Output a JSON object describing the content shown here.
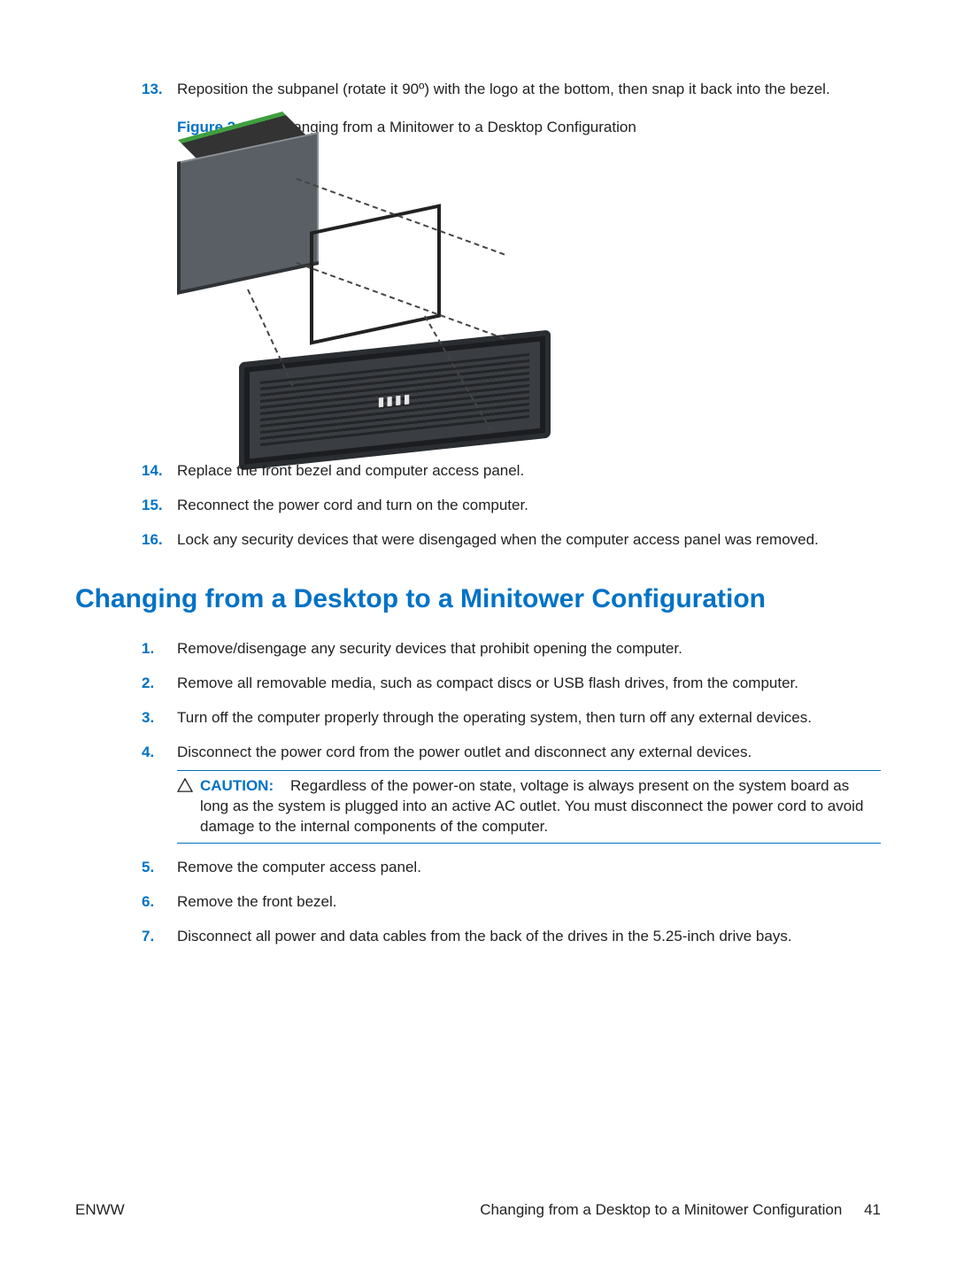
{
  "continued_steps": {
    "items": [
      {
        "num": "13.",
        "text": "Reposition the subpanel (rotate it 90º) with the logo at the bottom, then snap it back into the bezel."
      },
      {
        "num": "14.",
        "text": "Replace the front bezel and computer access panel."
      },
      {
        "num": "15.",
        "text": "Reconnect the power cord and turn on the computer."
      },
      {
        "num": "16.",
        "text": "Lock any security devices that were disengaged when the computer access panel was removed."
      }
    ]
  },
  "figure": {
    "label": "Figure 2-39",
    "caption": "Changing from a Minitower to a Desktop Configuration"
  },
  "section_heading": "Changing from a Desktop to a Minitower Configuration",
  "new_steps": {
    "items": [
      {
        "num": "1.",
        "text": "Remove/disengage any security devices that prohibit opening the computer."
      },
      {
        "num": "2.",
        "text": "Remove all removable media, such as compact discs or USB flash drives, from the computer."
      },
      {
        "num": "3.",
        "text": "Turn off the computer properly through the operating system, then turn off any external devices."
      },
      {
        "num": "4.",
        "text": "Disconnect the power cord from the power outlet and disconnect any external devices."
      },
      {
        "num": "5.",
        "text": "Remove the computer access panel."
      },
      {
        "num": "6.",
        "text": "Remove the front bezel."
      },
      {
        "num": "7.",
        "text": "Disconnect all power and data cables from the back of the drives in the 5.25-inch drive bays."
      }
    ]
  },
  "caution": {
    "label": "CAUTION:",
    "text": "Regardless of the power-on state, voltage is always present on the system board as long as the system is plugged into an active AC outlet. You must disconnect the power cord to avoid damage to the internal components of the computer."
  },
  "footer": {
    "left": "ENWW",
    "right_title": "Changing from a Desktop to a Minitower Configuration",
    "page_number": "41"
  }
}
